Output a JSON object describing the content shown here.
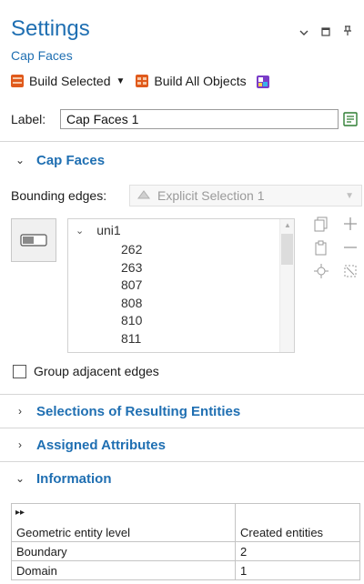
{
  "header": {
    "title": "Settings",
    "subtitle": "Cap Faces",
    "window_controls": [
      "chevron-down-icon",
      "restore-icon",
      "pin-icon"
    ]
  },
  "toolbar": {
    "build_selected_label": "Build Selected",
    "build_all_label": "Build All Objects"
  },
  "label_row": {
    "label": "Label:",
    "value": "Cap Faces 1"
  },
  "sections": {
    "cap_faces": "Cap Faces",
    "selections": "Selections of Resulting Entities",
    "assigned": "Assigned Attributes",
    "information": "Information"
  },
  "bounding": {
    "label": "Bounding edges:",
    "selected": "Explicit Selection 1"
  },
  "list": {
    "root": "uni1",
    "items": [
      "262",
      "263",
      "807",
      "808",
      "810",
      "811"
    ]
  },
  "checkbox": {
    "label": "Group adjacent edges"
  },
  "info_table": {
    "headers": [
      "Geometric entity level",
      "Created entities"
    ],
    "rows": [
      [
        "Boundary",
        "2"
      ],
      [
        "Domain",
        "1"
      ]
    ]
  },
  "colors": {
    "accent": "#1f6fb2",
    "build_icon": "#e05a1c"
  }
}
